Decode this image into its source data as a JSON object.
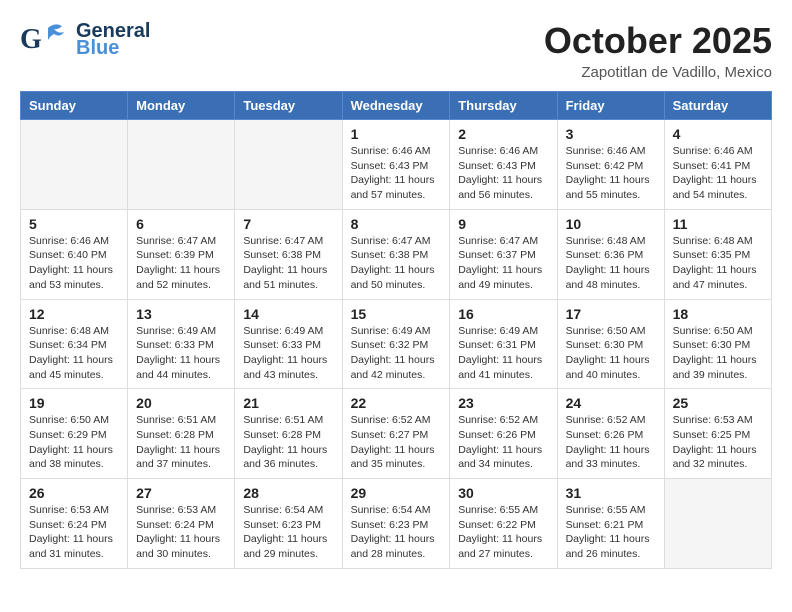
{
  "header": {
    "logo_general": "General",
    "logo_blue": "Blue",
    "month": "October 2025",
    "location": "Zapotitlan de Vadillo, Mexico"
  },
  "weekdays": [
    "Sunday",
    "Monday",
    "Tuesday",
    "Wednesday",
    "Thursday",
    "Friday",
    "Saturday"
  ],
  "weeks": [
    [
      {
        "day": "",
        "info": ""
      },
      {
        "day": "",
        "info": ""
      },
      {
        "day": "",
        "info": ""
      },
      {
        "day": "1",
        "info": "Sunrise: 6:46 AM\nSunset: 6:43 PM\nDaylight: 11 hours\nand 57 minutes."
      },
      {
        "day": "2",
        "info": "Sunrise: 6:46 AM\nSunset: 6:43 PM\nDaylight: 11 hours\nand 56 minutes."
      },
      {
        "day": "3",
        "info": "Sunrise: 6:46 AM\nSunset: 6:42 PM\nDaylight: 11 hours\nand 55 minutes."
      },
      {
        "day": "4",
        "info": "Sunrise: 6:46 AM\nSunset: 6:41 PM\nDaylight: 11 hours\nand 54 minutes."
      }
    ],
    [
      {
        "day": "5",
        "info": "Sunrise: 6:46 AM\nSunset: 6:40 PM\nDaylight: 11 hours\nand 53 minutes."
      },
      {
        "day": "6",
        "info": "Sunrise: 6:47 AM\nSunset: 6:39 PM\nDaylight: 11 hours\nand 52 minutes."
      },
      {
        "day": "7",
        "info": "Sunrise: 6:47 AM\nSunset: 6:38 PM\nDaylight: 11 hours\nand 51 minutes."
      },
      {
        "day": "8",
        "info": "Sunrise: 6:47 AM\nSunset: 6:38 PM\nDaylight: 11 hours\nand 50 minutes."
      },
      {
        "day": "9",
        "info": "Sunrise: 6:47 AM\nSunset: 6:37 PM\nDaylight: 11 hours\nand 49 minutes."
      },
      {
        "day": "10",
        "info": "Sunrise: 6:48 AM\nSunset: 6:36 PM\nDaylight: 11 hours\nand 48 minutes."
      },
      {
        "day": "11",
        "info": "Sunrise: 6:48 AM\nSunset: 6:35 PM\nDaylight: 11 hours\nand 47 minutes."
      }
    ],
    [
      {
        "day": "12",
        "info": "Sunrise: 6:48 AM\nSunset: 6:34 PM\nDaylight: 11 hours\nand 45 minutes."
      },
      {
        "day": "13",
        "info": "Sunrise: 6:49 AM\nSunset: 6:33 PM\nDaylight: 11 hours\nand 44 minutes."
      },
      {
        "day": "14",
        "info": "Sunrise: 6:49 AM\nSunset: 6:33 PM\nDaylight: 11 hours\nand 43 minutes."
      },
      {
        "day": "15",
        "info": "Sunrise: 6:49 AM\nSunset: 6:32 PM\nDaylight: 11 hours\nand 42 minutes."
      },
      {
        "day": "16",
        "info": "Sunrise: 6:49 AM\nSunset: 6:31 PM\nDaylight: 11 hours\nand 41 minutes."
      },
      {
        "day": "17",
        "info": "Sunrise: 6:50 AM\nSunset: 6:30 PM\nDaylight: 11 hours\nand 40 minutes."
      },
      {
        "day": "18",
        "info": "Sunrise: 6:50 AM\nSunset: 6:30 PM\nDaylight: 11 hours\nand 39 minutes."
      }
    ],
    [
      {
        "day": "19",
        "info": "Sunrise: 6:50 AM\nSunset: 6:29 PM\nDaylight: 11 hours\nand 38 minutes."
      },
      {
        "day": "20",
        "info": "Sunrise: 6:51 AM\nSunset: 6:28 PM\nDaylight: 11 hours\nand 37 minutes."
      },
      {
        "day": "21",
        "info": "Sunrise: 6:51 AM\nSunset: 6:28 PM\nDaylight: 11 hours\nand 36 minutes."
      },
      {
        "day": "22",
        "info": "Sunrise: 6:52 AM\nSunset: 6:27 PM\nDaylight: 11 hours\nand 35 minutes."
      },
      {
        "day": "23",
        "info": "Sunrise: 6:52 AM\nSunset: 6:26 PM\nDaylight: 11 hours\nand 34 minutes."
      },
      {
        "day": "24",
        "info": "Sunrise: 6:52 AM\nSunset: 6:26 PM\nDaylight: 11 hours\nand 33 minutes."
      },
      {
        "day": "25",
        "info": "Sunrise: 6:53 AM\nSunset: 6:25 PM\nDaylight: 11 hours\nand 32 minutes."
      }
    ],
    [
      {
        "day": "26",
        "info": "Sunrise: 6:53 AM\nSunset: 6:24 PM\nDaylight: 11 hours\nand 31 minutes."
      },
      {
        "day": "27",
        "info": "Sunrise: 6:53 AM\nSunset: 6:24 PM\nDaylight: 11 hours\nand 30 minutes."
      },
      {
        "day": "28",
        "info": "Sunrise: 6:54 AM\nSunset: 6:23 PM\nDaylight: 11 hours\nand 29 minutes."
      },
      {
        "day": "29",
        "info": "Sunrise: 6:54 AM\nSunset: 6:23 PM\nDaylight: 11 hours\nand 28 minutes."
      },
      {
        "day": "30",
        "info": "Sunrise: 6:55 AM\nSunset: 6:22 PM\nDaylight: 11 hours\nand 27 minutes."
      },
      {
        "day": "31",
        "info": "Sunrise: 6:55 AM\nSunset: 6:21 PM\nDaylight: 11 hours\nand 26 minutes."
      },
      {
        "day": "",
        "info": ""
      }
    ]
  ]
}
